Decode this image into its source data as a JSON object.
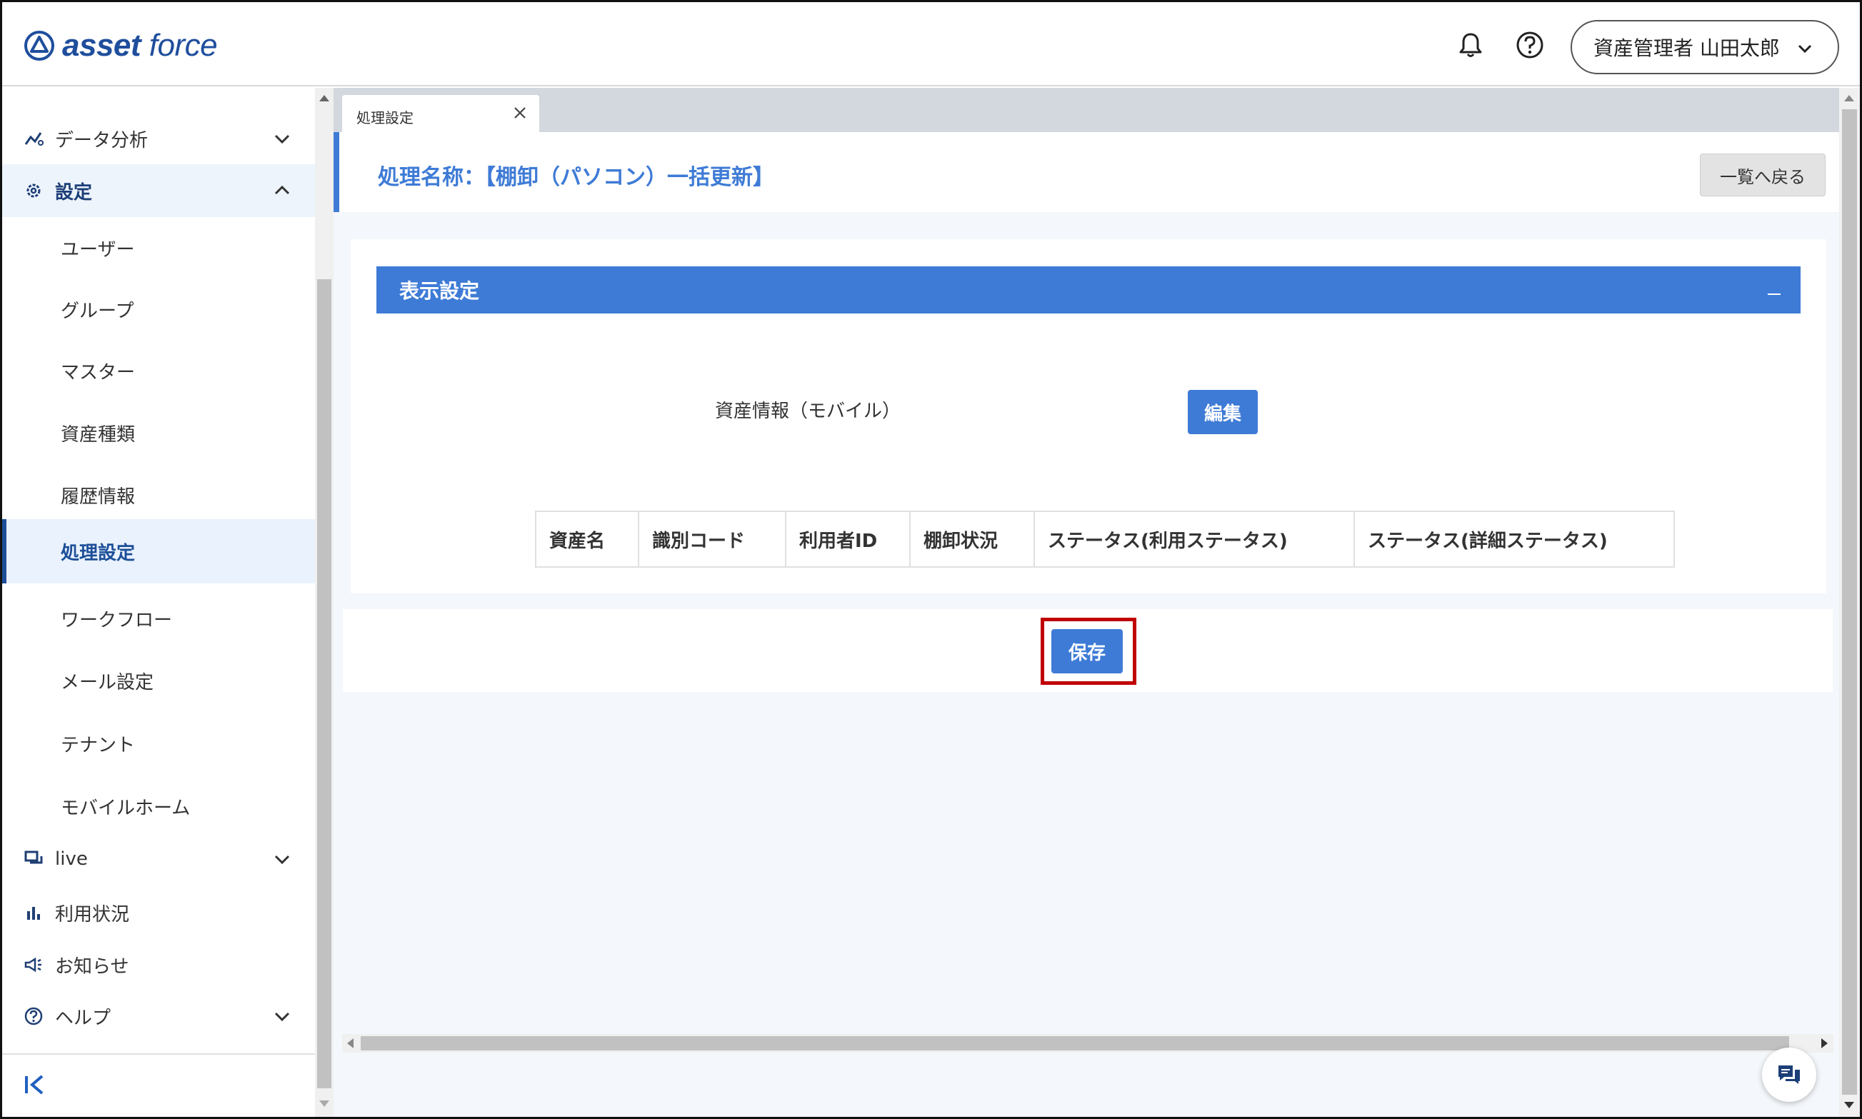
{
  "app": {
    "logo_text_bold": "asset",
    "logo_text_light": "force",
    "brand_color": "#1f4e9c",
    "accent_color": "#3e7bd6"
  },
  "header": {
    "notification_icon": "bell-icon",
    "help_icon": "help-circle-icon",
    "user_label": "資産管理者 山田太郎"
  },
  "sidebar": {
    "data_analysis": "データ分析",
    "settings": "設定",
    "settings_items": [
      "ユーザー",
      "グループ",
      "マスター",
      "資産種類",
      "履歴情報",
      "処理設定",
      "ワークフロー",
      "メール設定",
      "テナント",
      "モバイルホーム"
    ],
    "active_item": "処理設定",
    "live": "live",
    "usage": "利用状況",
    "news": "お知らせ",
    "help": "ヘルプ"
  },
  "tabs": [
    {
      "label": "処理設定"
    }
  ],
  "page": {
    "title": "処理名称：【棚卸（パソコン）一括更新】",
    "back_button": "一覧へ戻る"
  },
  "panel": {
    "header": "表示設定",
    "field_label": "資産情報（モバイル）",
    "edit_button": "編集",
    "columns": [
      "資産名",
      "識別コード",
      "利用者ID",
      "棚卸状況",
      "ステータス(利用ステータス)",
      "ステータス(詳細ステータス)"
    ]
  },
  "save_button": "保存",
  "highlight_color": "#c00000"
}
